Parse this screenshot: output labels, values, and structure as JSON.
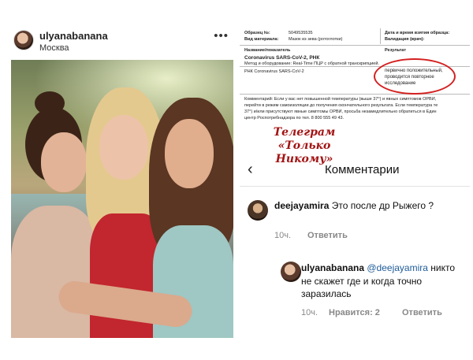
{
  "post": {
    "username": "ulyanabanana",
    "location": "Москва",
    "more_icon": "more-horizontal-icon"
  },
  "document": {
    "sample_no_label": "Образец №:",
    "sample_no_value": "5049535535",
    "material_label": "Вид материала:",
    "material_value": "Мазок из зева (ротоглотки)",
    "datetime_label": "Дата и время взятия образца:",
    "validation_label": "Валидация (врач):",
    "col_name": "Название/показатель",
    "col_result": "Результат",
    "test_name": "Coronavirus SARS-CoV-2, РНК",
    "method": "Метод и оборудование: Real-Time ПЦР с обратной транскрипцией.",
    "rnk": "РНК Coronavirus SARS-CoV-2",
    "result_lines": [
      "первично положительный,",
      "проводится повторное",
      "исследование"
    ],
    "comment_lines": [
      "Комментарий: Если у вас нет повышенной температуры (выше 37°) и явных симптомов ОРВИ,",
      "перейти в режим самоизоляции до получения окончательного результата. Если температура те",
      "37°) и/или присутствуют явные симптомы ОРВИ, просьба незамедлительно обратиться в Един",
      "центр Роспотребнадзора по тел. 8 800 555 49 43."
    ]
  },
  "watermark": {
    "line1": "Телеграм",
    "line2": "«Только",
    "line3": "Никому»"
  },
  "comments": {
    "title": "Комментарии",
    "back_icon": "chevron-left-icon",
    "items": [
      {
        "username": "deejayamira",
        "text": "Это после др Рыжего ?",
        "time": "10ч.",
        "reply": "Ответить"
      },
      {
        "username": "ulyanabanana",
        "mention": "@deejayamira",
        "text": "никто не скажет где и когда точно заразилась",
        "time": "10ч.",
        "likes": "Нравится: 2",
        "reply": "Ответить"
      }
    ]
  }
}
